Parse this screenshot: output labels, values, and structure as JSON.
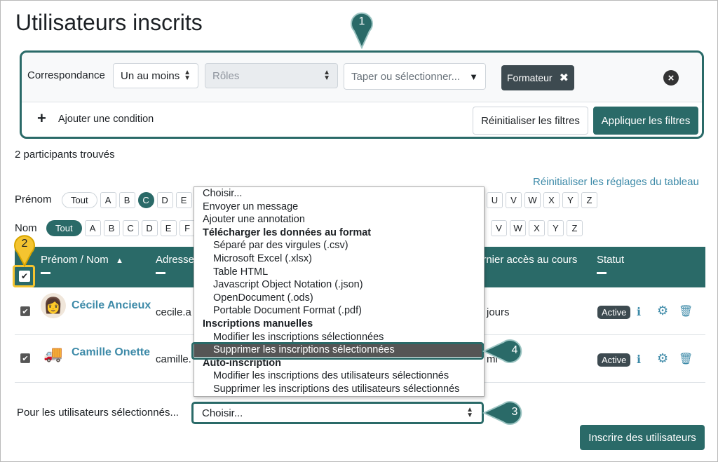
{
  "page": {
    "title": "Utilisateurs inscrits"
  },
  "filters": {
    "match_label": "Correspondance",
    "match_value": "Un au moins",
    "roles_placeholder": "Rôles",
    "type_placeholder": "Taper ou sélectionner...",
    "tag_label": "Formateur",
    "add_condition": "Ajouter une condition",
    "reset_label": "Réinitialiser les filtres",
    "apply_label": "Appliquer les filtres"
  },
  "callouts": {
    "one": "1",
    "two": "2",
    "three": "3",
    "four": "4"
  },
  "results": {
    "count_text": "2 participants trouvés",
    "reset_table": "Réinitialiser les réglages du tableau"
  },
  "initials": {
    "firstname_label": "Prénom",
    "lastname_label": "Nom",
    "all": "Tout",
    "firstname_letters_left": [
      "A",
      "B",
      "C",
      "D",
      "E"
    ],
    "firstname_active": "C",
    "firstname_letters_right": [
      "U",
      "V",
      "W",
      "X",
      "Y",
      "Z"
    ],
    "lastname_letters_left": [
      "A",
      "B",
      "C",
      "D",
      "E",
      "F"
    ],
    "lastname_letters_right": [
      "V",
      "W",
      "X",
      "Y",
      "Z"
    ]
  },
  "table": {
    "col_name": "Prénom / Nom",
    "col_email": "Adresse",
    "col_lastaccess": "ernier accès au cours",
    "col_status": "Statut",
    "rows": [
      {
        "name": "Cécile Ancieux",
        "email": "cecile.a",
        "lastaccess": "jours",
        "status": "Active"
      },
      {
        "name": "Camille Onette",
        "email": "camille.",
        "lastaccess": "mi",
        "status": "Active"
      }
    ]
  },
  "dropdown": {
    "options": [
      {
        "label": "Choisir...",
        "kind": "opt"
      },
      {
        "label": "Envoyer un message",
        "kind": "opt"
      },
      {
        "label": "Ajouter une annotation",
        "kind": "opt"
      },
      {
        "label": "Télécharger les données au format",
        "kind": "group"
      },
      {
        "label": "Séparé par des virgules (.csv)",
        "kind": "sub"
      },
      {
        "label": "Microsoft Excel (.xlsx)",
        "kind": "sub"
      },
      {
        "label": "Table HTML",
        "kind": "sub"
      },
      {
        "label": "Javascript Object Notation (.json)",
        "kind": "sub"
      },
      {
        "label": "OpenDocument (.ods)",
        "kind": "sub"
      },
      {
        "label": "Portable Document Format (.pdf)",
        "kind": "sub"
      },
      {
        "label": "Inscriptions manuelles",
        "kind": "group"
      },
      {
        "label": "Modifier les inscriptions sélectionnées",
        "kind": "sub"
      },
      {
        "label": "Supprimer les inscriptions sélectionnées",
        "kind": "sub-hl"
      },
      {
        "label": "Auto-inscription",
        "kind": "group"
      },
      {
        "label": "Modifier les inscriptions des utilisateurs sélectionnés",
        "kind": "sub"
      },
      {
        "label": "Supprimer les inscriptions des utilisateurs sélectionnés",
        "kind": "sub"
      }
    ]
  },
  "bulk": {
    "label": "Pour les utilisateurs sélectionnés...",
    "value": "Choisir..."
  },
  "enrol_button": "Inscrire des utilisateurs"
}
